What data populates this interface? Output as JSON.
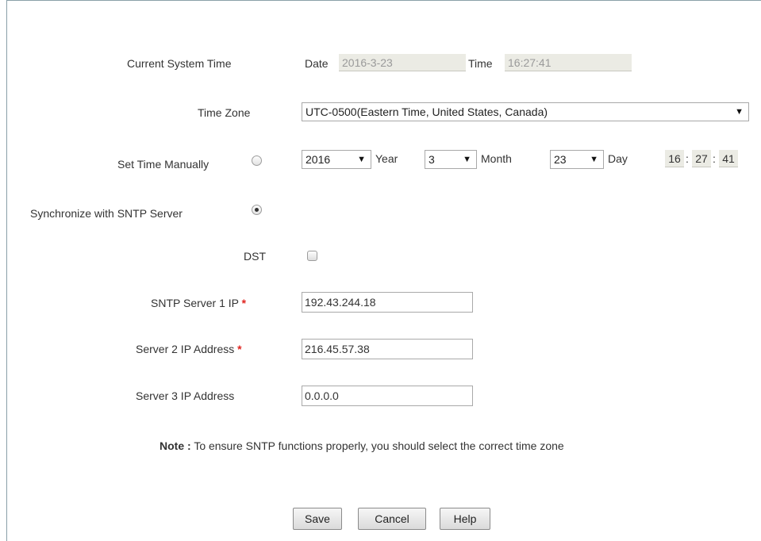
{
  "current_time": {
    "label": "Current System Time",
    "date_label": "Date",
    "date_value": "2016-3-23",
    "time_label": "Time",
    "time_value": "16:27:41"
  },
  "time_zone": {
    "label": "Time Zone",
    "selected": "UTC-0500(Eastern Time, United States, Canada)"
  },
  "manual": {
    "label": "Set Time Manually",
    "selected": false,
    "year_value": "2016",
    "year_label": "Year",
    "month_value": "3",
    "month_label": "Month",
    "day_value": "23",
    "day_label": "Day",
    "hour": "16",
    "minute": "27",
    "second": "41",
    "colon": ":"
  },
  "sntp": {
    "label": "Synchronize with SNTP Server",
    "selected": true
  },
  "dst": {
    "label": "DST",
    "checked": false
  },
  "servers": {
    "server1_label": "SNTP Server 1 IP",
    "server1_value": "192.43.244.18",
    "server2_label": "Server 2 IP Address",
    "server2_value": "216.45.57.38",
    "server3_label": "Server 3 IP Address",
    "server3_value": "0.0.0.0",
    "required_mark": "*"
  },
  "note": {
    "prefix": "Note :",
    "text": "To ensure SNTP functions properly, you should select the correct time zone"
  },
  "buttons": {
    "save": "Save",
    "cancel": "Cancel",
    "help": "Help"
  },
  "icons": {
    "dropdown": "triangle-down"
  },
  "colors": {
    "required": "#e0241f",
    "readonly_bg": "#ebebe4"
  }
}
